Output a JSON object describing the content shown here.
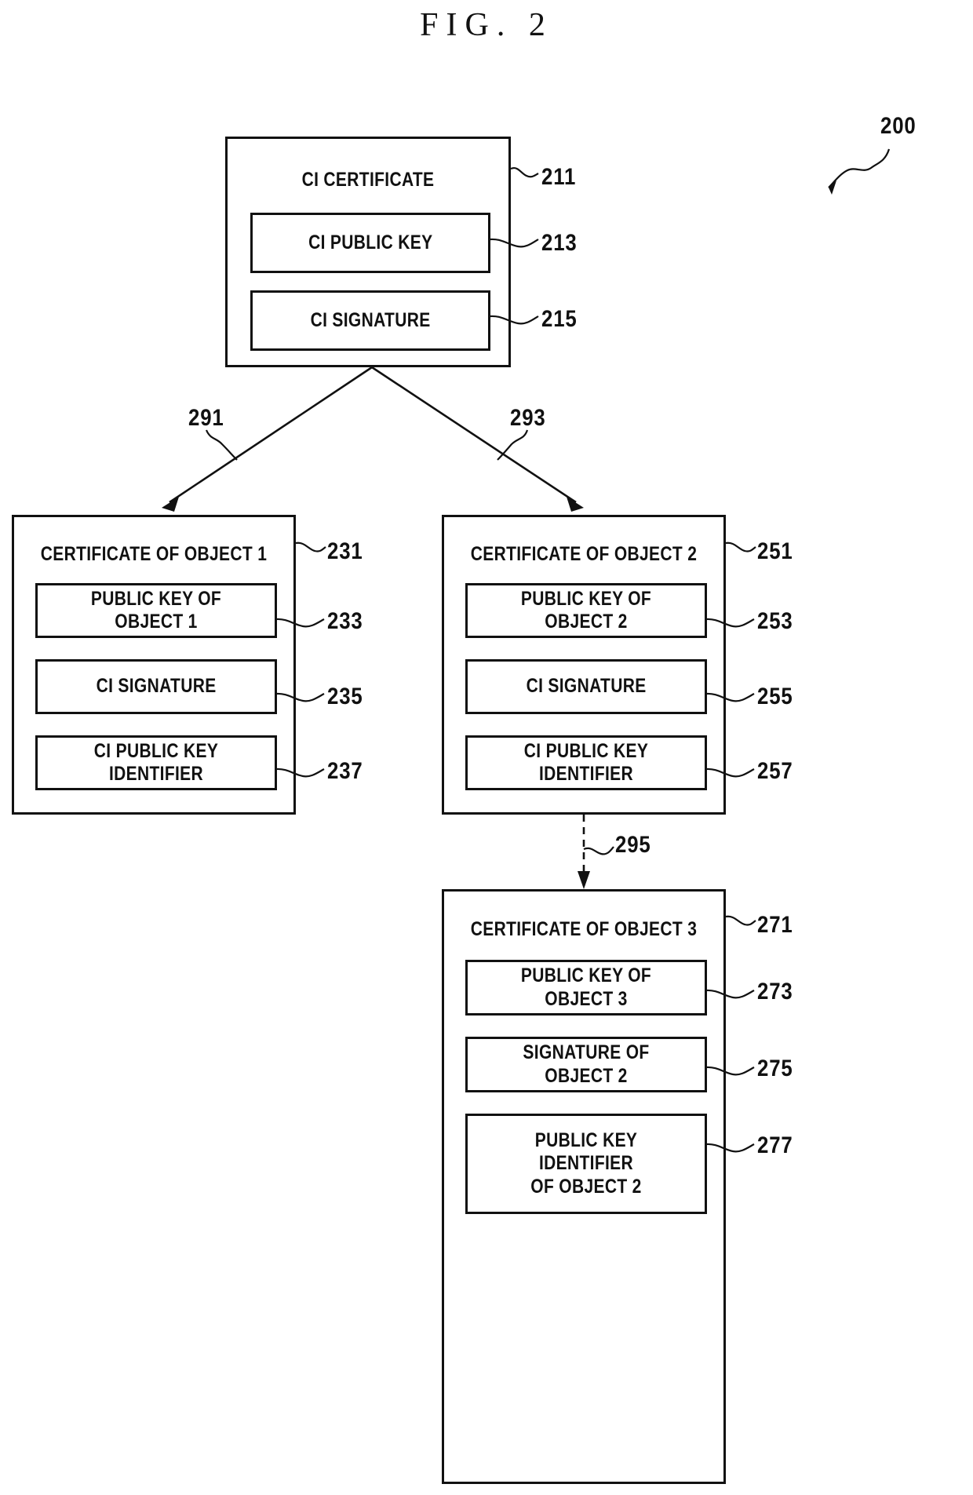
{
  "figure": {
    "title": "FIG. 2",
    "system_ref": "200"
  },
  "nodes": {
    "ci_certificate": {
      "title": "CI CERTIFICATE",
      "ref": "211",
      "fields": [
        {
          "label": "CI PUBLIC KEY",
          "ref": "213"
        },
        {
          "label": "CI SIGNATURE",
          "ref": "215"
        }
      ]
    },
    "certificate_object_1": {
      "title": "CERTIFICATE OF OBJECT 1",
      "ref": "231",
      "fields": [
        {
          "label": "PUBLIC KEY OF OBJECT 1",
          "ref": "233"
        },
        {
          "label": "CI SIGNATURE",
          "ref": "235"
        },
        {
          "label": "CI PUBLIC KEY IDENTIFIER",
          "ref": "237"
        }
      ]
    },
    "certificate_object_2": {
      "title": "CERTIFICATE OF OBJECT 2",
      "ref": "251",
      "fields": [
        {
          "label": "PUBLIC KEY OF OBJECT 2",
          "ref": "253"
        },
        {
          "label": "CI SIGNATURE",
          "ref": "255"
        },
        {
          "label": "CI PUBLIC KEY IDENTIFIER",
          "ref": "257"
        }
      ]
    },
    "certificate_object_3": {
      "title": "CERTIFICATE OF OBJECT 3",
      "ref": "271",
      "fields": [
        {
          "label": "PUBLIC KEY OF OBJECT 3",
          "ref": "273"
        },
        {
          "label": "SIGNATURE OF OBJECT 2",
          "ref": "275"
        },
        {
          "label": "PUBLIC KEY IDENTIFIER\nOF OBJECT 2",
          "ref": "277"
        }
      ]
    }
  },
  "connectors": [
    {
      "id": "ci-to-object1",
      "ref": "291",
      "style": "solid-arrow"
    },
    {
      "id": "ci-to-object2",
      "ref": "293",
      "style": "solid-arrow"
    },
    {
      "id": "object2-to-object3",
      "ref": "295",
      "style": "dashed-arrow"
    }
  ],
  "colors": {
    "ink": "#111111",
    "paper": "#ffffff"
  }
}
